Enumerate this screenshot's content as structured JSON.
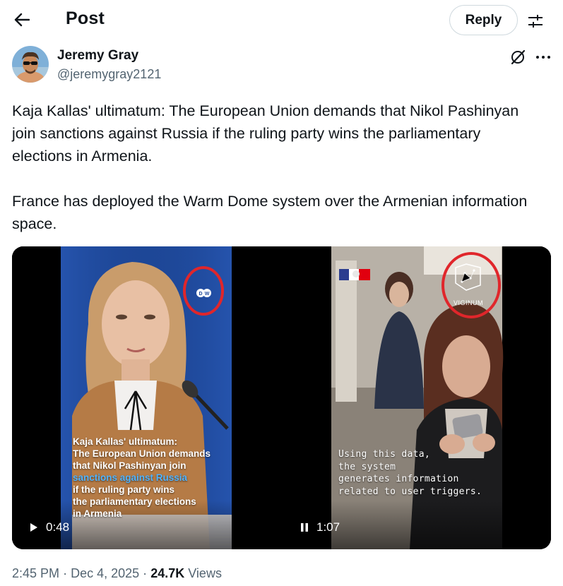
{
  "header": {
    "title": "Post",
    "reply_label": "Reply"
  },
  "author": {
    "name": "Jeremy Gray",
    "handle": "@jeremygray2121"
  },
  "post": {
    "paragraph1": "Kaja Kallas' ultimatum: The European Union demands that Nikol Pashinyan join sanctions against Russia if the ruling party wins the parliamentary elections in Armenia.",
    "paragraph2": "France has deployed the Warm Dome system over the Armenian information space."
  },
  "media": {
    "video1": {
      "caption_line1": "Kaja Kallas' ultimatum:",
      "caption_line2": "The European Union demands",
      "caption_line3": "that Nikol Pashinyan join",
      "caption_highlight": "sanctions against Russia",
      "caption_line5": "if the ruling party wins",
      "caption_line6": "the parliamentary elections",
      "caption_line7": "in Armenia",
      "duration": "0:48",
      "state_icon": "play-icon",
      "logo": "DW"
    },
    "video2": {
      "caption_line1": "Using this data,",
      "caption_line2": "the system",
      "caption_line3": "generates information",
      "caption_line4": "related to user triggers.",
      "duration": "1:07",
      "state_icon": "pause-icon",
      "logo": "VIGINUM"
    }
  },
  "meta": {
    "time": "2:45 PM",
    "separator": "·",
    "date": "Dec 4, 2025",
    "views_count": "24.7K",
    "views_label": "Views"
  },
  "colors": {
    "text_primary": "#0f1419",
    "text_secondary": "#536471",
    "caption_highlight": "#4fb3ff",
    "annotation_circle": "#e0262b"
  }
}
